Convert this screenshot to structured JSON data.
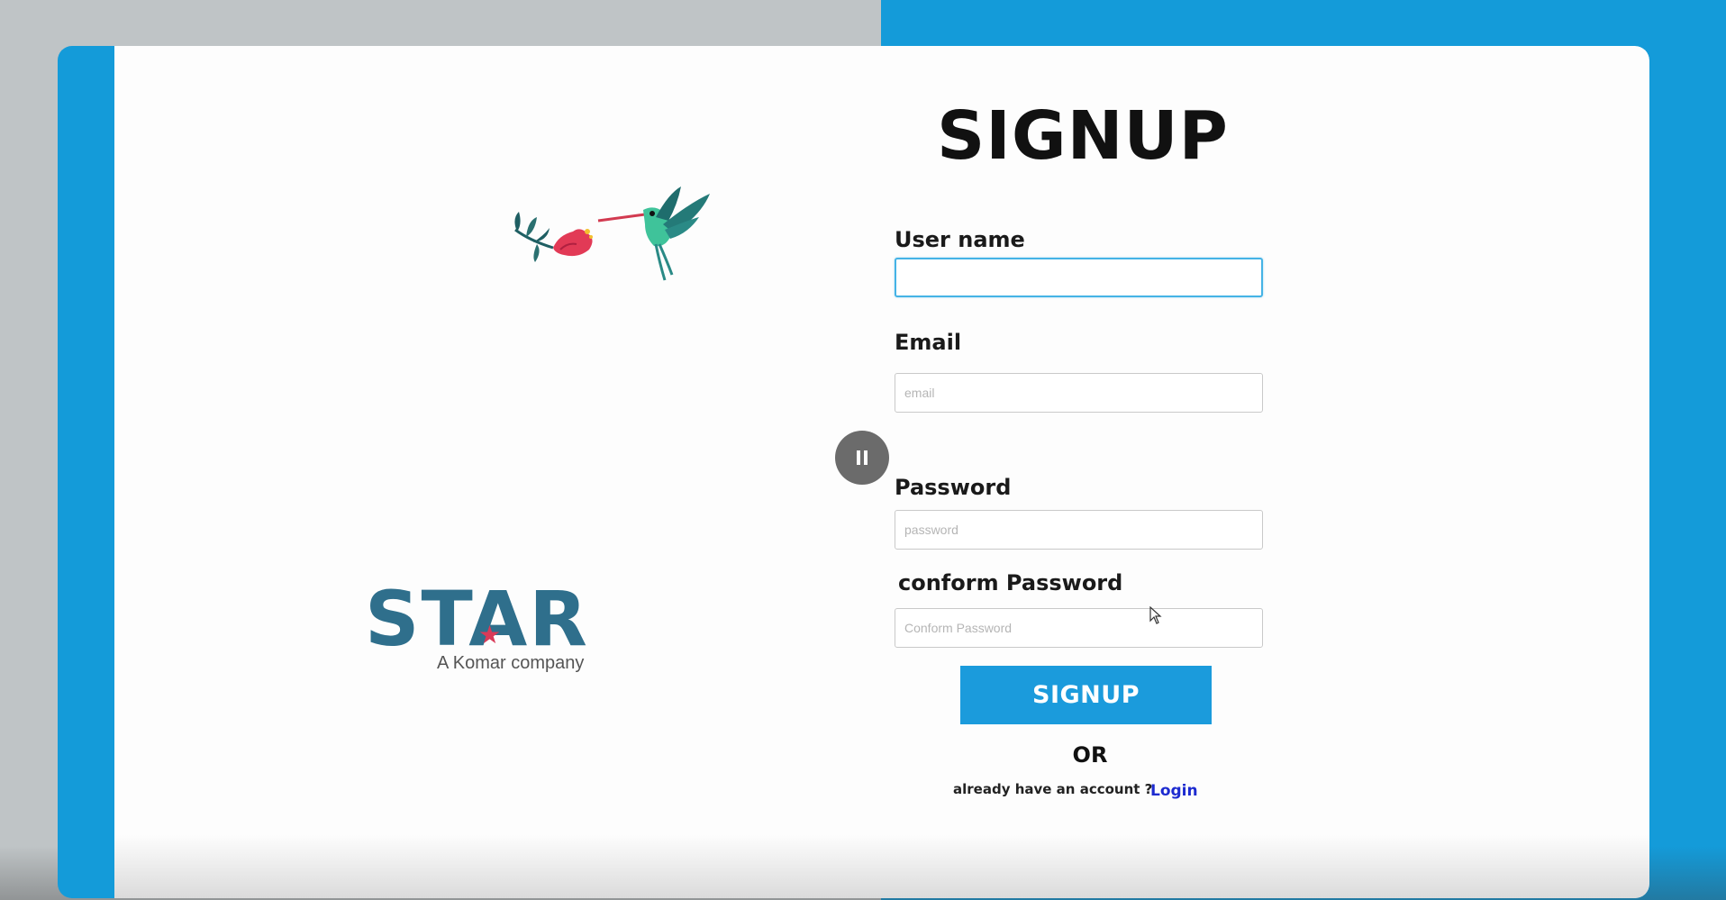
{
  "page": {
    "title": "SIGNUP"
  },
  "form": {
    "username": {
      "label": "User name",
      "value": "",
      "placeholder": ""
    },
    "email": {
      "label": "Email",
      "value": "",
      "placeholder": "email"
    },
    "password": {
      "label": "Password",
      "value": "",
      "placeholder": "password"
    },
    "confirm_password": {
      "label": "conform Password",
      "value": "",
      "placeholder": "Conform Password"
    },
    "submit_label": "SIGNUP",
    "or_text": "OR",
    "already_text": "already have an account  ?",
    "login_label": "Login"
  },
  "brand": {
    "logo_text": "STAR",
    "logo_subtitle": "A Komar company",
    "logo_color": "#2f6f8c",
    "star_color": "#d93a58"
  },
  "theme": {
    "accent": "#149bd9",
    "button": "#1b9bdc",
    "link": "#1d2bd0"
  },
  "icons": {
    "illustration": "hummingbird-flower-icon",
    "overlay": "pause-icon"
  }
}
